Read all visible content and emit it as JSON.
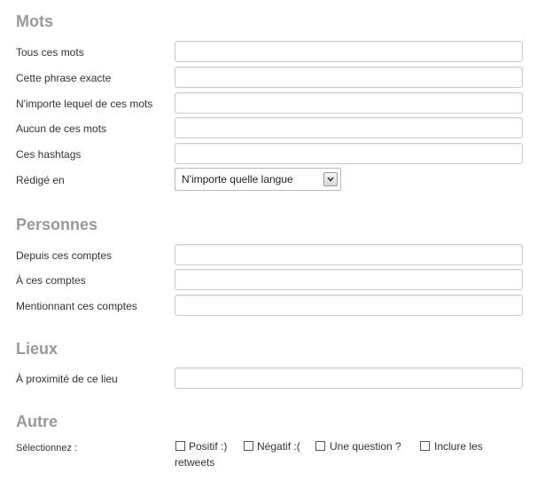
{
  "sections": {
    "mots": {
      "title": "Mots",
      "fields": [
        {
          "label": "Tous ces mots",
          "value": ""
        },
        {
          "label": "Cette phrase exacte",
          "value": ""
        },
        {
          "label": "N'importe lequel de ces mots",
          "value": ""
        },
        {
          "label": "Aucun de ces mots",
          "value": ""
        },
        {
          "label": "Ces hashtags",
          "value": ""
        }
      ],
      "language": {
        "label": "Rédigé en",
        "selected": "N'importe quelle langue"
      }
    },
    "personnes": {
      "title": "Personnes",
      "fields": [
        {
          "label": "Depuis ces comptes",
          "value": ""
        },
        {
          "label": "À ces comptes",
          "value": ""
        },
        {
          "label": "Mentionnant ces comptes",
          "value": ""
        }
      ]
    },
    "lieux": {
      "title": "Lieux",
      "fields": [
        {
          "label": "À proximité de ce lieu",
          "value": ""
        }
      ]
    },
    "autre": {
      "title": "Autre",
      "select_label": "Sélectionnez :",
      "options": [
        {
          "label": "Positif :)",
          "checked": false
        },
        {
          "label": "Négatif :(",
          "checked": false
        },
        {
          "label": "Une question ?",
          "checked": false
        },
        {
          "label": "Inclure les",
          "checked": false
        }
      ],
      "wrap_text": "retweets"
    }
  },
  "icons": {
    "select_arrow": "chevron-down-icon"
  }
}
